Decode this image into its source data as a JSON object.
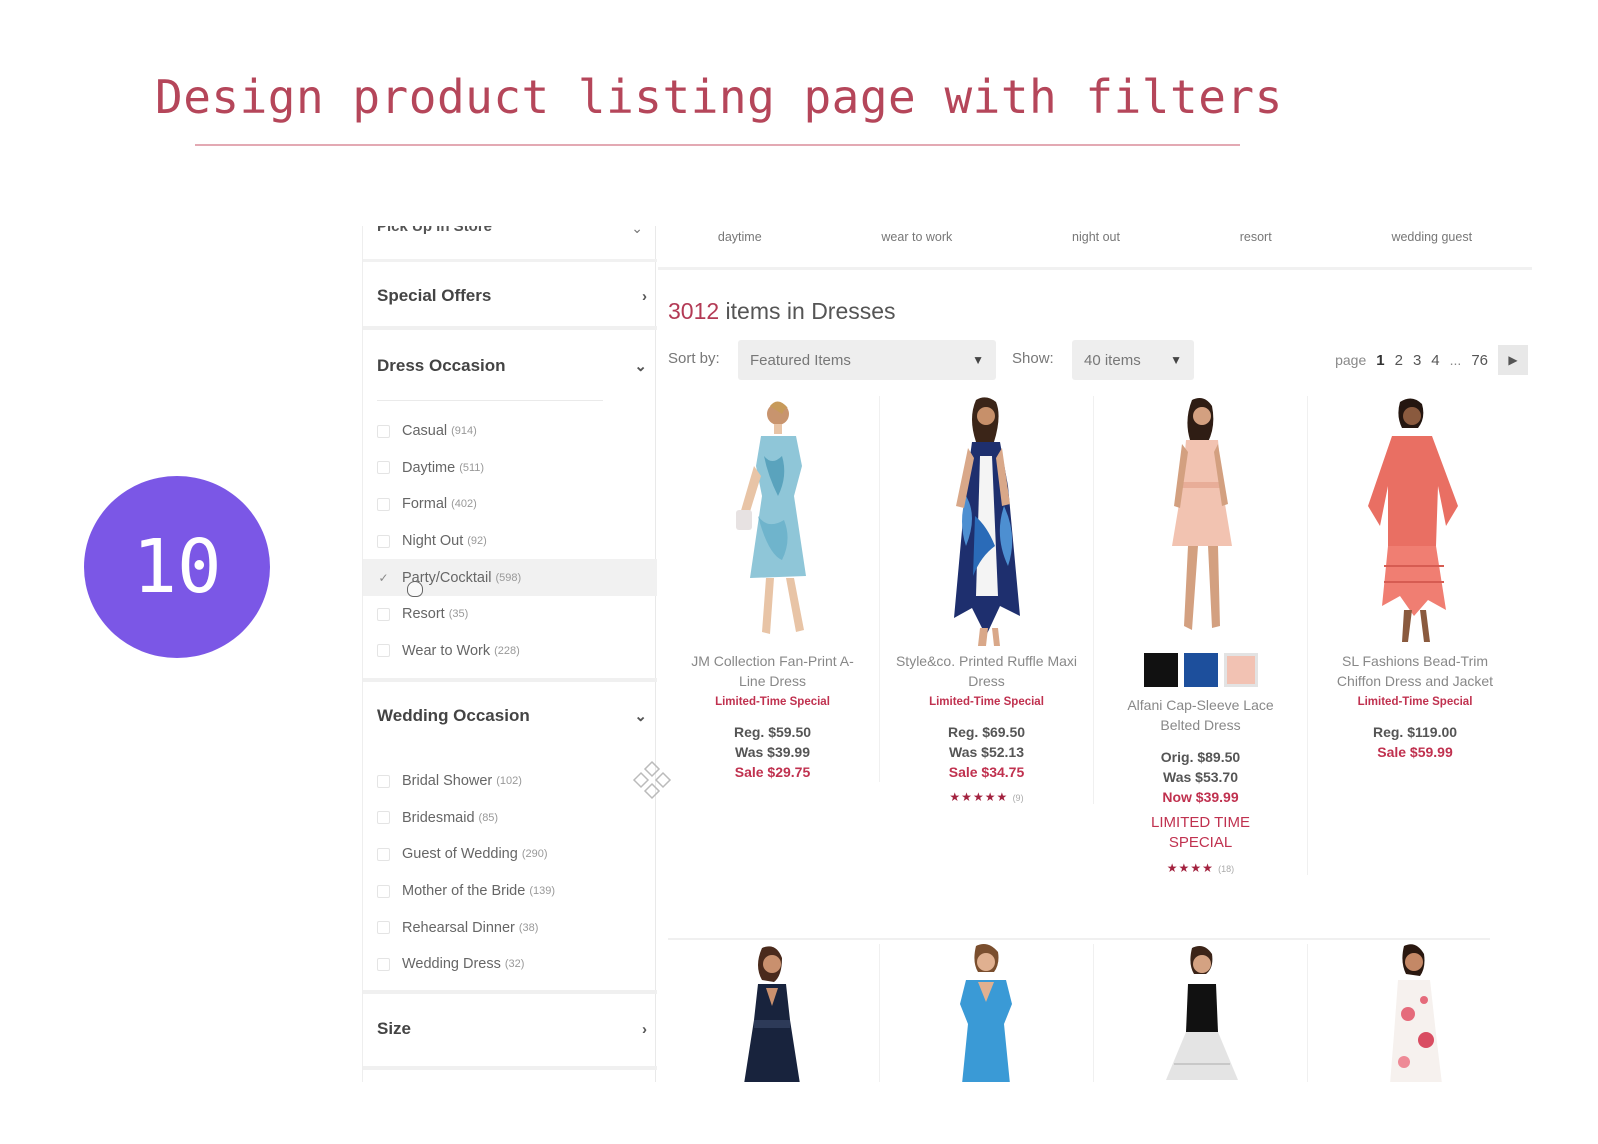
{
  "slide": {
    "title": "Design product listing page with filters",
    "number": "10"
  },
  "colors": {
    "accent": "#b5465a",
    "badge": "#7b57e6",
    "sale": "#c0314f"
  },
  "sidebar": {
    "cut_off_heading": "Pick Up in Store",
    "special_offers": "Special Offers",
    "dress_occasion": {
      "heading": "Dress Occasion",
      "options": [
        {
          "label": "Casual",
          "count": "(914)",
          "checked": false
        },
        {
          "label": "Daytime",
          "count": "(511)",
          "checked": false
        },
        {
          "label": "Formal",
          "count": "(402)",
          "checked": false
        },
        {
          "label": "Night Out",
          "count": "(92)",
          "checked": false
        },
        {
          "label": "Party/Cocktail",
          "count": "(598)",
          "checked": true
        },
        {
          "label": "Resort",
          "count": "(35)",
          "checked": false
        },
        {
          "label": "Wear to Work",
          "count": "(228)",
          "checked": false
        }
      ]
    },
    "wedding_occasion": {
      "heading": "Wedding Occasion",
      "options": [
        {
          "label": "Bridal Shower",
          "count": "(102)"
        },
        {
          "label": "Bridesmaid",
          "count": "(85)"
        },
        {
          "label": "Guest of Wedding",
          "count": "(290)"
        },
        {
          "label": "Mother of the Bride",
          "count": "(139)"
        },
        {
          "label": "Rehearsal Dinner",
          "count": "(38)"
        },
        {
          "label": "Wedding Dress",
          "count": "(32)"
        }
      ]
    },
    "size": "Size"
  },
  "main": {
    "tabs": [
      "daytime",
      "wear to work",
      "night out",
      "resort",
      "wedding guest"
    ],
    "items_count": "3012",
    "items_suffix": " items in Dresses",
    "sort_label": "Sort by:",
    "sort_value": "Featured Items",
    "show_label": "Show:",
    "show_value": "40 items",
    "pager": {
      "label": "page",
      "pages": [
        "1",
        "2",
        "3",
        "4"
      ],
      "dots": "...",
      "last": "76"
    },
    "products": [
      {
        "name": "JM Collection Fan-Print A-Line Dress",
        "promo": "Limited-Time Special",
        "reg": "Reg. $59.50",
        "was": "Was $39.99",
        "sale": "Sale $29.75"
      },
      {
        "name": "Style&co. Printed Ruffle Maxi Dress",
        "promo": "Limited-Time Special",
        "reg": "Reg. $69.50",
        "was": "Was $52.13",
        "sale": "Sale $34.75",
        "stars": "★★★★★",
        "rating_count": "(9)"
      },
      {
        "name": "Alfani Cap-Sleeve Lace Belted Dress",
        "orig": "Orig. $89.50",
        "was": "Was $53.70",
        "now": "Now $39.99",
        "big_promo": "LIMITED TIME SPECIAL",
        "stars": "★★★★",
        "rating_count": "(18)",
        "swatches": [
          "#111111",
          "#1d4f9c",
          "#f2c2b3"
        ]
      },
      {
        "name": "SL Fashions Bead-Trim Chiffon Dress and Jacket",
        "promo": "Limited-Time Special",
        "reg": "Reg. $119.00",
        "sale": "Sale $59.99"
      }
    ]
  }
}
